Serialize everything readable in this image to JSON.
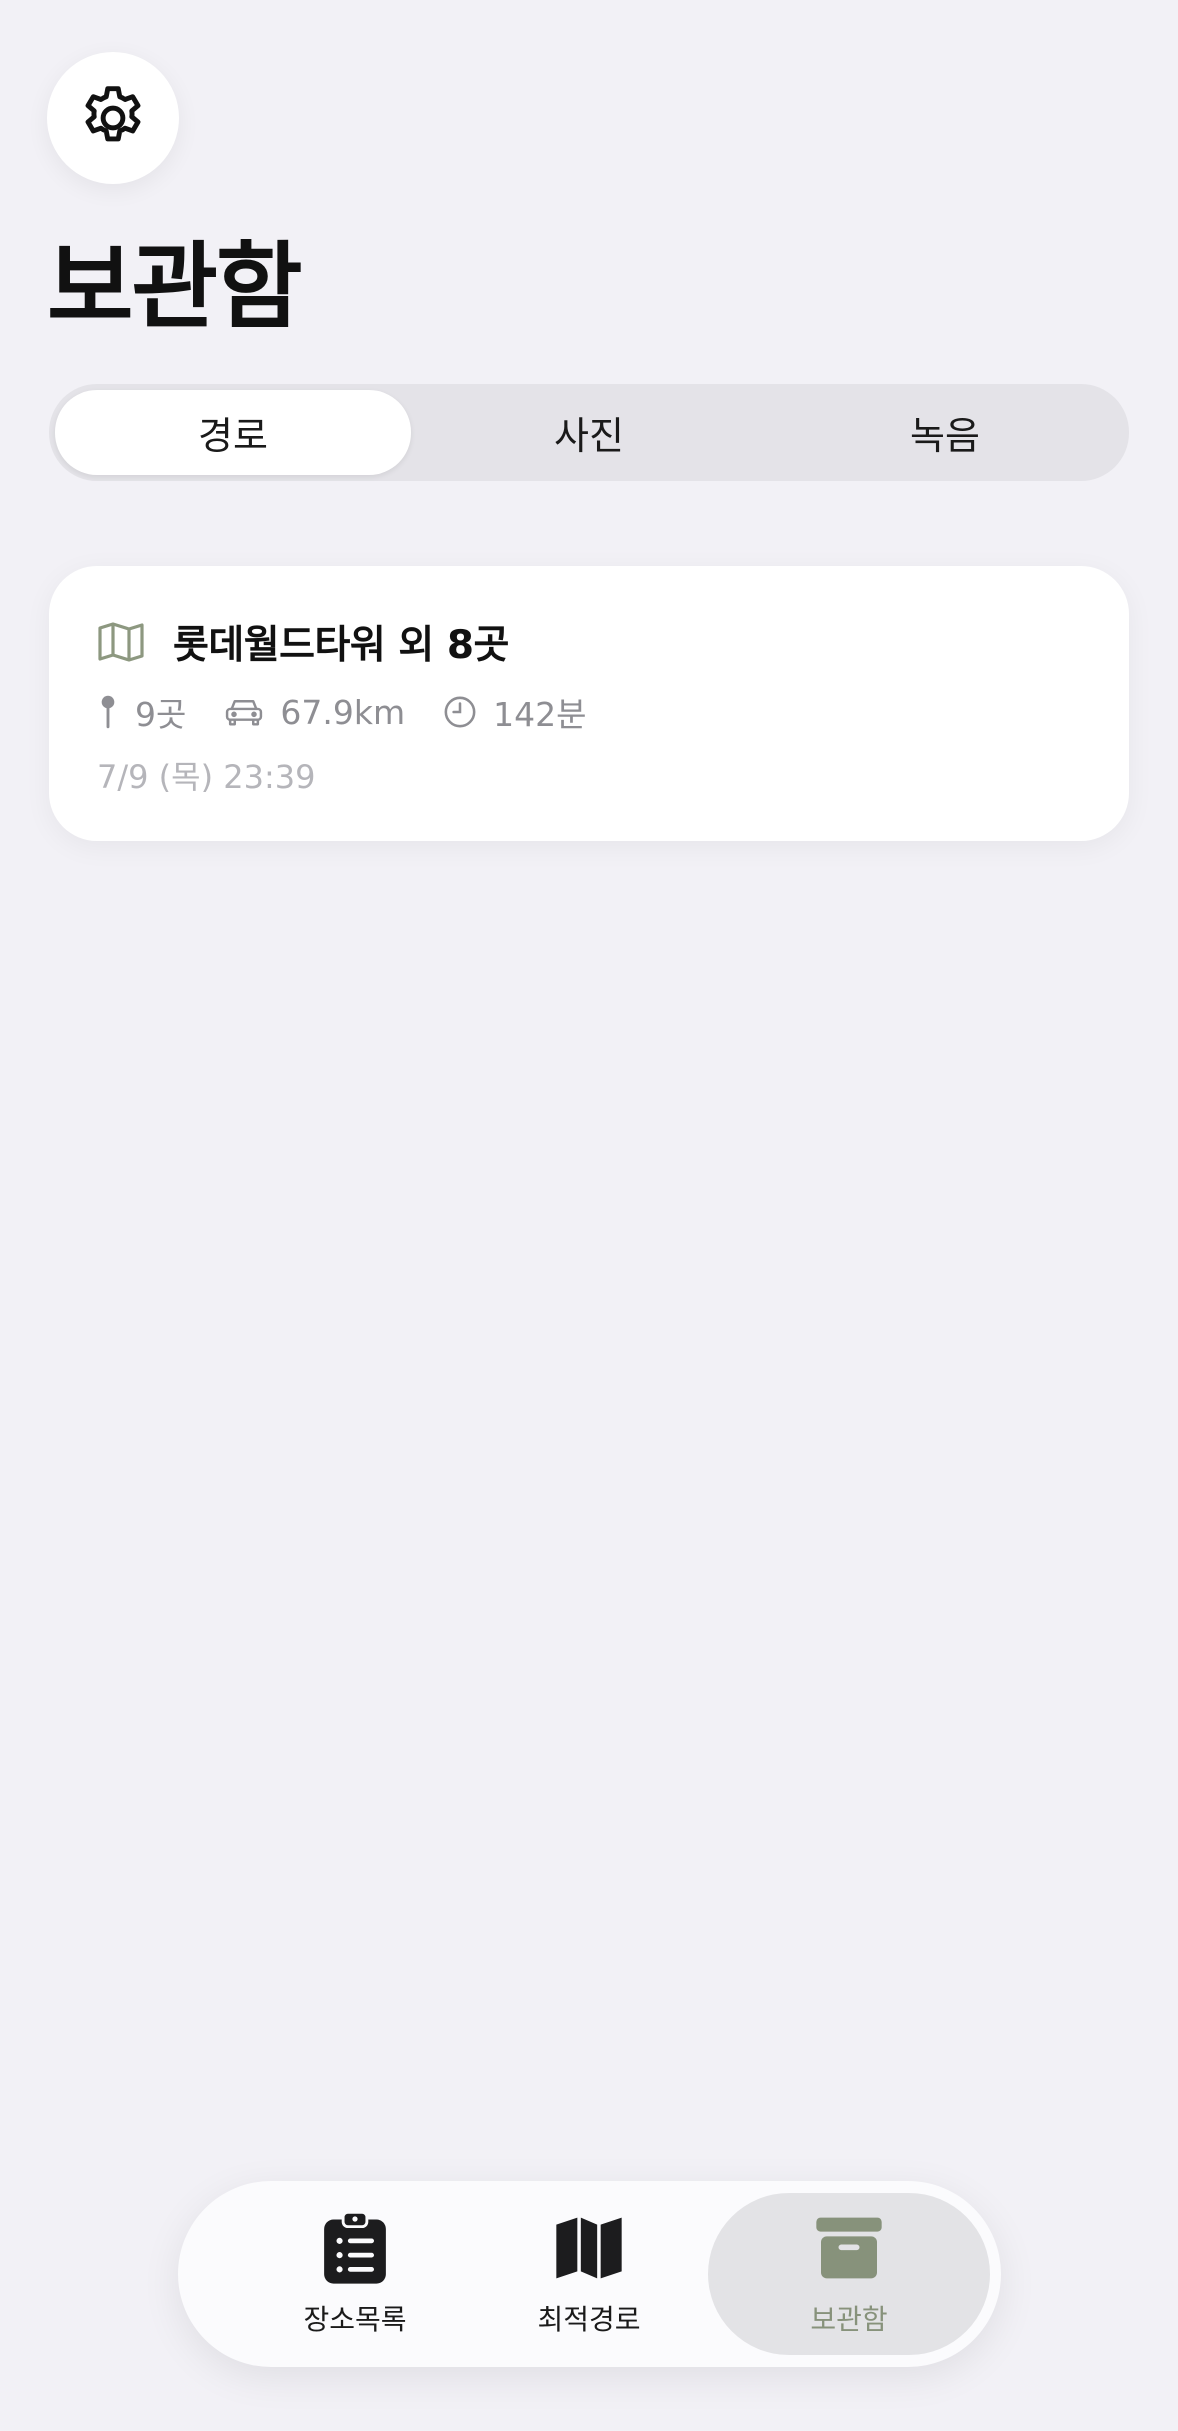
{
  "header": {
    "settings_icon": "gear-icon",
    "title": "보관함"
  },
  "segments": [
    {
      "label": "경로",
      "active": true
    },
    {
      "label": "사진",
      "active": false
    },
    {
      "label": "녹음",
      "active": false
    }
  ],
  "routes": [
    {
      "icon": "map-icon",
      "title": "롯데월드타워 외 8곳",
      "places": "9곳",
      "distance": "67.9km",
      "duration": "142분",
      "date": "7/9 (목) 23:39"
    }
  ],
  "tabbar": {
    "items": [
      {
        "label": "장소목록",
        "icon": "clipboard-list-icon",
        "active": false
      },
      {
        "label": "최적경로",
        "icon": "map-icon",
        "active": false
      },
      {
        "label": "보관함",
        "icon": "archive-box-icon",
        "active": true
      }
    ]
  },
  "colors": {
    "background": "#f2f1f6",
    "accent": "#87927b",
    "meta_text": "#8e8e93"
  }
}
